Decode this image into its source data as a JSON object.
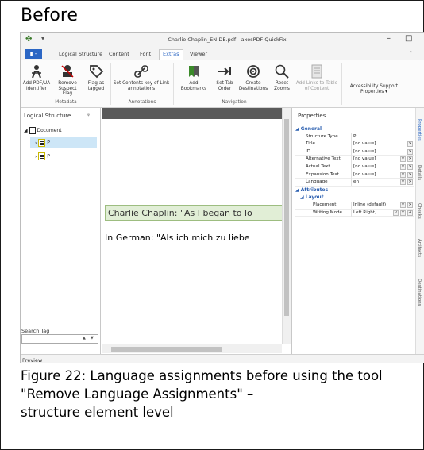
{
  "heading": "Before",
  "window": {
    "title": "Charlie Chaplin_EN-DE.pdf - axesPDF QuickFix",
    "min": "–",
    "max": "□"
  },
  "tabs": {
    "file": "▮ -",
    "items": [
      "Logical Structure",
      "Content",
      "Font",
      "Extras",
      "Viewer"
    ],
    "active": "Extras"
  },
  "ribbon": {
    "buttons": [
      {
        "id": "add-pdfua",
        "label": "Add PDF/UA identifier",
        "icon": "person-icon"
      },
      {
        "id": "remove-suspect",
        "label": "Remove Suspect Flag",
        "icon": "suspect-icon"
      },
      {
        "id": "flag-tagged",
        "label": "Flag as tagged",
        "icon": "tag-icon"
      },
      {
        "id": "set-contents",
        "label": "Set Contents key of Link annotations",
        "icon": "link-icon"
      },
      {
        "id": "add-bookmarks",
        "label": "Add Bookmarks",
        "icon": "bookmark-icon"
      },
      {
        "id": "set-tab-order",
        "label": "Set Tab Order",
        "icon": "tab-arrow-icon"
      },
      {
        "id": "create-destinations",
        "label": "Create Destinations",
        "icon": "target-icon"
      },
      {
        "id": "reset-zooms",
        "label": "Reset Zooms",
        "icon": "magnifier-icon"
      },
      {
        "id": "add-links-toc",
        "label": "Add Links to Table of Content",
        "icon": "toc-icon"
      },
      {
        "id": "accessibility-props",
        "label": "Accessibility Support Properties ▾",
        "icon": "none"
      }
    ],
    "groups": [
      "Metadata",
      "Annotations",
      "Navigation"
    ]
  },
  "left_panel": {
    "title": "Logical Structure ...",
    "pin": "ᵠ",
    "tree": [
      {
        "label": "Document"
      },
      {
        "label": "P"
      },
      {
        "label": "P"
      }
    ],
    "search_label": "Search Tag"
  },
  "document": {
    "line1": "Charlie Chaplin: \"As I began to lo",
    "line2": "In German: \"Als ich mich zu liebe"
  },
  "properties": {
    "title": "Properties",
    "sections": {
      "general": "General",
      "attributes": "Attributes",
      "layout": "Layout"
    },
    "general_rows": [
      {
        "key": "Structure Type",
        "value": "P",
        "buttons": ""
      },
      {
        "key": "Title",
        "value": "[no value]",
        "buttons": "x"
      },
      {
        "key": "ID",
        "value": "[no value]",
        "buttons": "x"
      },
      {
        "key": "Alternative Text",
        "value": "[no value]",
        "buttons": "vx"
      },
      {
        "key": "Actual Text",
        "value": "[no value]",
        "buttons": "vx"
      },
      {
        "key": "Expansion Text",
        "value": "[no value]",
        "buttons": "vx"
      },
      {
        "key": "Language",
        "value": "en",
        "buttons": "vx"
      }
    ],
    "layout_rows": [
      {
        "key": "Placement",
        "value": "Inline (default)",
        "buttons": "vx"
      },
      {
        "key": "Writing Mode",
        "value": "Left Right, ...",
        "buttons": "vx+"
      }
    ]
  },
  "side_tabs": [
    "Properties",
    "Details",
    "Checks",
    "Artifacts",
    "Destinations"
  ],
  "status": {
    "preview": "Preview"
  },
  "caption": "Figure 22: Language assignments before using the tool \"Remove Language Assignments\" –\nstructure element level",
  "colors": {
    "accent": "#2b66c4",
    "highlight": "#e1eed6",
    "tree_icon_yellow": "#e8d200"
  }
}
